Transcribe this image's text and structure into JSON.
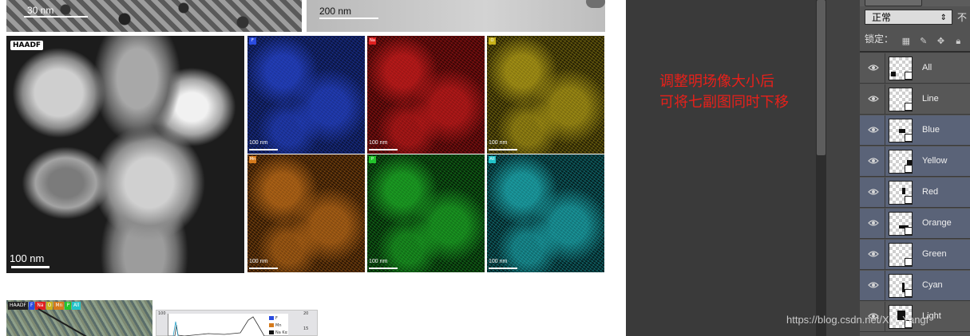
{
  "canvas": {
    "top_left_scale": "30 nm",
    "top_right_scale": "200 nm",
    "haadf_label": "HAADF",
    "haadf_scale": "100 nm",
    "map_scale": "100 nm",
    "maps": [
      {
        "tag": "F",
        "color": "#2a4be0",
        "base": "#0b1540"
      },
      {
        "tag": "Na",
        "color": "#e02020",
        "base": "#3a0606"
      },
      {
        "tag": "O",
        "color": "#c9b21a",
        "base": "#262104"
      },
      {
        "tag": "Mn",
        "color": "#d57a1c",
        "base": "#2d1704"
      },
      {
        "tag": "P",
        "color": "#22c42b",
        "base": "#052108"
      },
      {
        "tag": "All",
        "color": "#22c3c9",
        "base": "#041f21"
      }
    ],
    "bottom_legend": [
      "HAADF",
      "F",
      "Na",
      "O",
      "Mn",
      "P",
      "All"
    ],
    "bottom_legend_colors": [
      "#222222",
      "#2a4be0",
      "#e02020",
      "#c9b21a",
      "#d57a1c",
      "#22c42b",
      "#22c3c9"
    ],
    "plot_legend": [
      "F",
      "Mn",
      "Na Kα"
    ],
    "plot_axis_left_top": "100",
    "plot_axis_right_top": "20",
    "plot_axis_right_mid": "15"
  },
  "annotation": {
    "line1": "调整明场像大小后",
    "line2": "可将七副图同时下移",
    "color": "#e8201a"
  },
  "layers_panel": {
    "blend_mode": "正常",
    "opacity_label": "不",
    "lock_label": "锁定：",
    "layers": [
      {
        "name": "All",
        "selected": false
      },
      {
        "name": "Line",
        "selected": false
      },
      {
        "name": "Blue",
        "selected": true
      },
      {
        "name": "Yellow",
        "selected": true
      },
      {
        "name": "Red",
        "selected": true
      },
      {
        "name": "Orange",
        "selected": true
      },
      {
        "name": "Green",
        "selected": true
      },
      {
        "name": "Cyan",
        "selected": true
      },
      {
        "name": "Light",
        "selected": false
      }
    ]
  },
  "watermark": "https://blog.csdn.net/XD_Yangf"
}
